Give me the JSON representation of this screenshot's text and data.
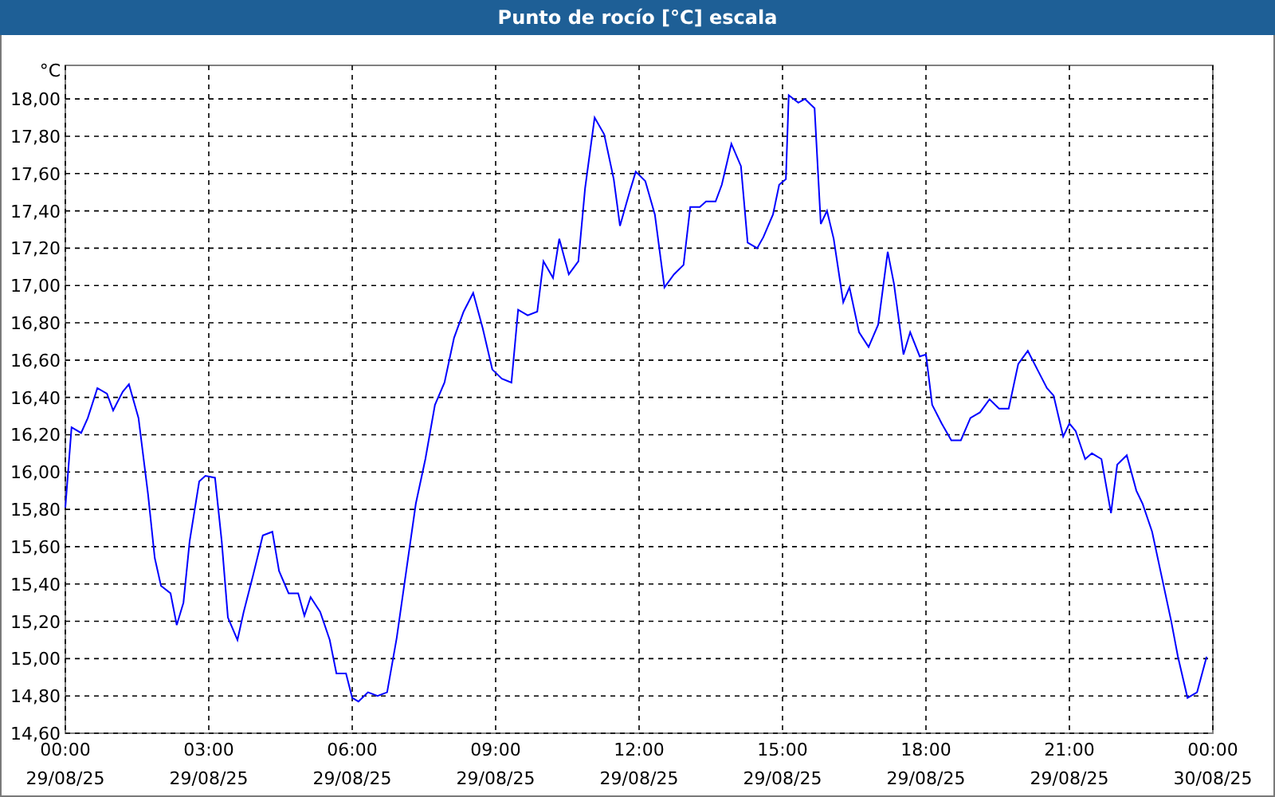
{
  "window": {
    "title": "Punto de rocío [°C] escala"
  },
  "chart": {
    "xtick_dates": [
      "29/08/25",
      "29/08/25",
      "29/08/25",
      "29/08/25",
      "29/08/25",
      "29/08/25",
      "29/08/25",
      "29/08/25",
      "30/08/25"
    ],
    "chart_data": {
      "type": "line",
      "grid": true,
      "ylabel": "°C",
      "xlim": [
        0,
        24
      ],
      "ylim": [
        14.6,
        18.18
      ],
      "xticks": [
        {
          "value": 0,
          "label": "00:00"
        },
        {
          "value": 3,
          "label": "03:00"
        },
        {
          "value": 6,
          "label": "06:00"
        },
        {
          "value": 9,
          "label": "09:00"
        },
        {
          "value": 12,
          "label": "12:00"
        },
        {
          "value": 15,
          "label": "15:00"
        },
        {
          "value": 18,
          "label": "18:00"
        },
        {
          "value": 21,
          "label": "21:00"
        },
        {
          "value": 24,
          "label": "00:00"
        }
      ],
      "yticks": [
        {
          "value": 14.6,
          "label": "14,60"
        },
        {
          "value": 14.8,
          "label": "14,80"
        },
        {
          "value": 15,
          "label": "15,00"
        },
        {
          "value": 15.2,
          "label": "15,20"
        },
        {
          "value": 15.4,
          "label": "15,40"
        },
        {
          "value": 15.6,
          "label": "15,60"
        },
        {
          "value": 15.8,
          "label": "15,80"
        },
        {
          "value": 16,
          "label": "16,00"
        },
        {
          "value": 16.2,
          "label": "16,20"
        },
        {
          "value": 16.4,
          "label": "16,40"
        },
        {
          "value": 16.6,
          "label": "16,60"
        },
        {
          "value": 16.8,
          "label": "16,80"
        },
        {
          "value": 17,
          "label": "17,00"
        },
        {
          "value": 17.2,
          "label": "17,20"
        },
        {
          "value": 17.4,
          "label": "17,40"
        },
        {
          "value": 17.6,
          "label": "17,60"
        },
        {
          "value": 17.8,
          "label": "17,80"
        },
        {
          "value": 18,
          "label": "18,00"
        }
      ],
      "x": [
        0,
        0.13,
        0.33,
        0.47,
        0.67,
        0.87,
        1,
        1.2,
        1.33,
        1.53,
        1.73,
        1.87,
        2,
        2.2,
        2.33,
        2.47,
        2.6,
        2.8,
        2.93,
        3.13,
        3.27,
        3.4,
        3.6,
        3.73,
        3.93,
        4.13,
        4.33,
        4.47,
        4.67,
        4.87,
        5,
        5.13,
        5.33,
        5.53,
        5.67,
        5.87,
        6,
        6.13,
        6.33,
        6.53,
        6.73,
        6.93,
        7.13,
        7.33,
        7.53,
        7.73,
        7.93,
        8.13,
        8.33,
        8.53,
        8.73,
        8.93,
        9.13,
        9.33,
        9.47,
        9.67,
        9.87,
        10,
        10.2,
        10.33,
        10.53,
        10.73,
        10.87,
        11.07,
        11.27,
        11.47,
        11.6,
        11.8,
        11.93,
        12.13,
        12.33,
        12.53,
        12.73,
        12.93,
        13.07,
        13.27,
        13.4,
        13.6,
        13.73,
        13.93,
        14.13,
        14.27,
        14.47,
        14.6,
        14.8,
        14.93,
        15.07,
        15.13,
        15.33,
        15.47,
        15.67,
        15.8,
        15.93,
        16.07,
        16.27,
        16.4,
        16.6,
        16.8,
        17,
        17.2,
        17.33,
        17.53,
        17.67,
        17.87,
        18,
        18.13,
        18.33,
        18.53,
        18.73,
        18.93,
        19.13,
        19.33,
        19.53,
        19.73,
        19.93,
        20.13,
        20.33,
        20.53,
        20.67,
        20.87,
        21,
        21.13,
        21.33,
        21.47,
        21.67,
        21.87,
        22,
        22.2,
        22.4,
        22.53,
        22.73,
        22.93,
        23.13,
        23.27,
        23.47,
        23.67,
        23.87
      ],
      "series": [
        {
          "color": "#0000ff",
          "values": [
            15.81,
            16.24,
            16.21,
            16.29,
            16.45,
            16.42,
            16.33,
            16.43,
            16.47,
            16.29,
            15.88,
            15.54,
            15.39,
            15.35,
            15.18,
            15.3,
            15.63,
            15.95,
            15.98,
            15.97,
            15.63,
            15.22,
            15.1,
            15.25,
            15.45,
            15.66,
            15.68,
            15.47,
            15.35,
            15.35,
            15.23,
            15.33,
            15.25,
            15.1,
            14.92,
            14.92,
            14.79,
            14.77,
            14.82,
            14.8,
            14.82,
            15.11,
            15.47,
            15.83,
            16.07,
            16.36,
            16.48,
            16.72,
            16.86,
            16.96,
            16.77,
            16.55,
            16.5,
            16.48,
            16.87,
            16.84,
            16.86,
            17.13,
            17.04,
            17.25,
            17.06,
            17.13,
            17.52,
            17.9,
            17.81,
            17.57,
            17.32,
            17.5,
            17.61,
            17.56,
            17.38,
            16.99,
            17.06,
            17.11,
            17.42,
            17.42,
            17.45,
            17.45,
            17.54,
            17.76,
            17.64,
            17.23,
            17.2,
            17.26,
            17.38,
            17.54,
            17.57,
            18.02,
            17.98,
            18,
            17.95,
            17.33,
            17.4,
            17.25,
            16.91,
            16.99,
            16.75,
            16.67,
            16.79,
            17.18,
            17.01,
            16.63,
            16.75,
            16.62,
            16.63,
            16.36,
            16.26,
            16.17,
            16.17,
            16.29,
            16.32,
            16.39,
            16.34,
            16.34,
            16.58,
            16.65,
            16.55,
            16.45,
            16.41,
            16.19,
            16.26,
            16.22,
            16.07,
            16.1,
            16.07,
            15.78,
            16.04,
            16.09,
            15.9,
            15.83,
            15.68,
            15.44,
            15.2,
            15.01,
            14.79,
            14.82,
            15.01
          ]
        }
      ]
    }
  }
}
